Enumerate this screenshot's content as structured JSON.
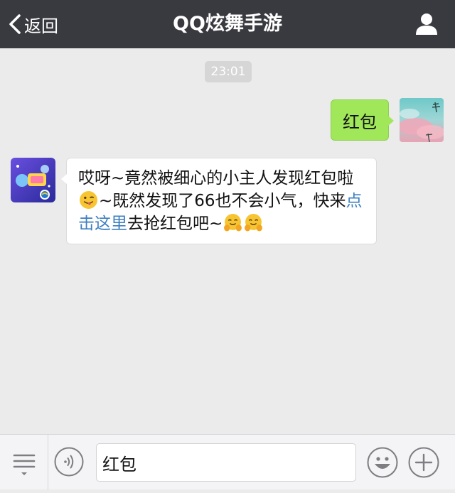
{
  "header": {
    "back_label": "返回",
    "title": "QQ炫舞手游"
  },
  "chat": {
    "timestamp": "23:01",
    "outgoing_message": "红包",
    "incoming_message": {
      "part1": "哎呀~竟然被细心的小主人发现红包啦",
      "part2": "~既然发现了66也不会小气，快来",
      "link_text": "点击这里",
      "part3": "去抢红包吧~"
    }
  },
  "composer": {
    "input_value": "红包"
  },
  "colors": {
    "topbar": "#393a3f",
    "chat_background": "#ebebeb",
    "outgoing_bubble": "#a0e75a",
    "link": "#3d7fc1"
  }
}
